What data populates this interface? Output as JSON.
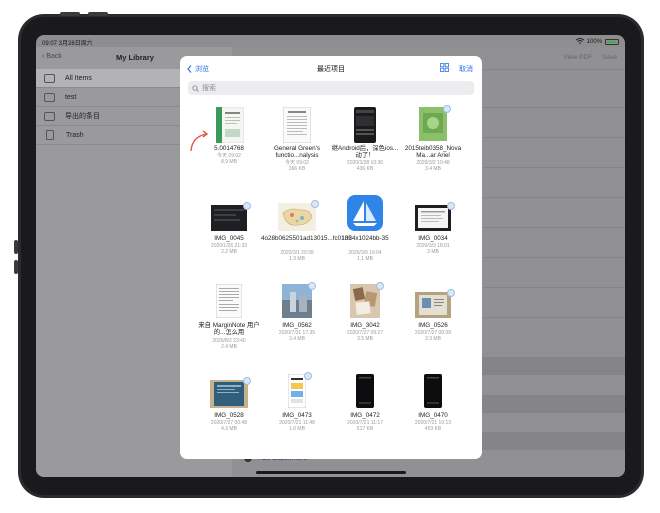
{
  "status": {
    "time": "09:07  3月28日周六",
    "battery": "100%"
  },
  "sidebar": {
    "back_label": "Back",
    "title": "My Library",
    "items": [
      {
        "label": "All Items",
        "icon": "stack-icon"
      },
      {
        "label": "test",
        "icon": "folder-icon"
      },
      {
        "label": "导出的条目",
        "icon": "folder-icon"
      },
      {
        "label": "Trash",
        "icon": "trash-icon"
      }
    ]
  },
  "detail": {
    "view_pdf": "View PDF",
    "save": "Save",
    "attachment": "Add attachment"
  },
  "picker": {
    "back_label": "浏览",
    "title": "最近项目",
    "cancel": "取消",
    "search_placeholder": "搜索",
    "files": [
      {
        "name": "5.0014768",
        "date": "今天 09:02",
        "size": "8.9 MB"
      },
      {
        "name": "General Green's functio...nalysis",
        "date": "今天 09:02",
        "size": "366 KB"
      },
      {
        "name": "继Android后，深色ios...动了！",
        "date": "2020/3/28 10:30",
        "size": "436 KB"
      },
      {
        "name": "2015teib0358_Nova Ma...ar Ariel",
        "date": "2020/3/2 10:48",
        "size": "3.4 MB"
      },
      {
        "name": "IMG_0045",
        "date": "2020/1/26 21:33",
        "size": "2.2 MB"
      },
      {
        "name": "4o28b0625501ad13015...fc0135",
        "date": "2020/3/1 20:39",
        "size": "1.3 MB"
      },
      {
        "name": "1024x1024bb-35",
        "date": "2020/3/9 16:04",
        "size": "1.1 MB"
      },
      {
        "name": "IMG_0034",
        "date": "2020/3/3 18:01",
        "size": "3 MB"
      },
      {
        "name": "来自 MarginNote 用户的...怎么用",
        "date": "2020/8/2 23:40",
        "size": "2.4 MB"
      },
      {
        "name": "IMG_0562",
        "date": "2020/7/31 17:35",
        "size": "3.4 MB"
      },
      {
        "name": "IMG_3042",
        "date": "2020/7/27 09:27",
        "size": "3.5 MB"
      },
      {
        "name": "IMG_0526",
        "date": "2020/7/27 00:09",
        "size": "3.3 MB"
      },
      {
        "name": "IMG_0528",
        "date": "2020/7/27 00:48",
        "size": "4.3 MB"
      },
      {
        "name": "IMG_0473",
        "date": "2020/7/21 11:48",
        "size": "1.6 MB"
      },
      {
        "name": "IMG_0472",
        "date": "2020/7/21 11:17",
        "size": "517 KB"
      },
      {
        "name": "IMG_0470",
        "date": "2020/7/21 10:13",
        "size": "453 KB"
      }
    ]
  },
  "colors": {
    "accent": "#2a72e6",
    "dim": "#8e8e91",
    "arrow": "#e0533c"
  }
}
